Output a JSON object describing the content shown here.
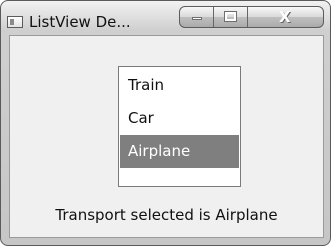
{
  "window": {
    "title": "ListView De..."
  },
  "caption_controls": {
    "minimize": "",
    "maximize": "",
    "close": "X"
  },
  "listview": {
    "items": [
      {
        "label": "Train"
      },
      {
        "label": "Car"
      },
      {
        "label": "Airplane"
      }
    ],
    "selected_index": 2
  },
  "status": {
    "text": "Transport selected is Airplane"
  },
  "colors": {
    "selection_background": "#7f7f7f",
    "selection_text": "#ffffff"
  }
}
